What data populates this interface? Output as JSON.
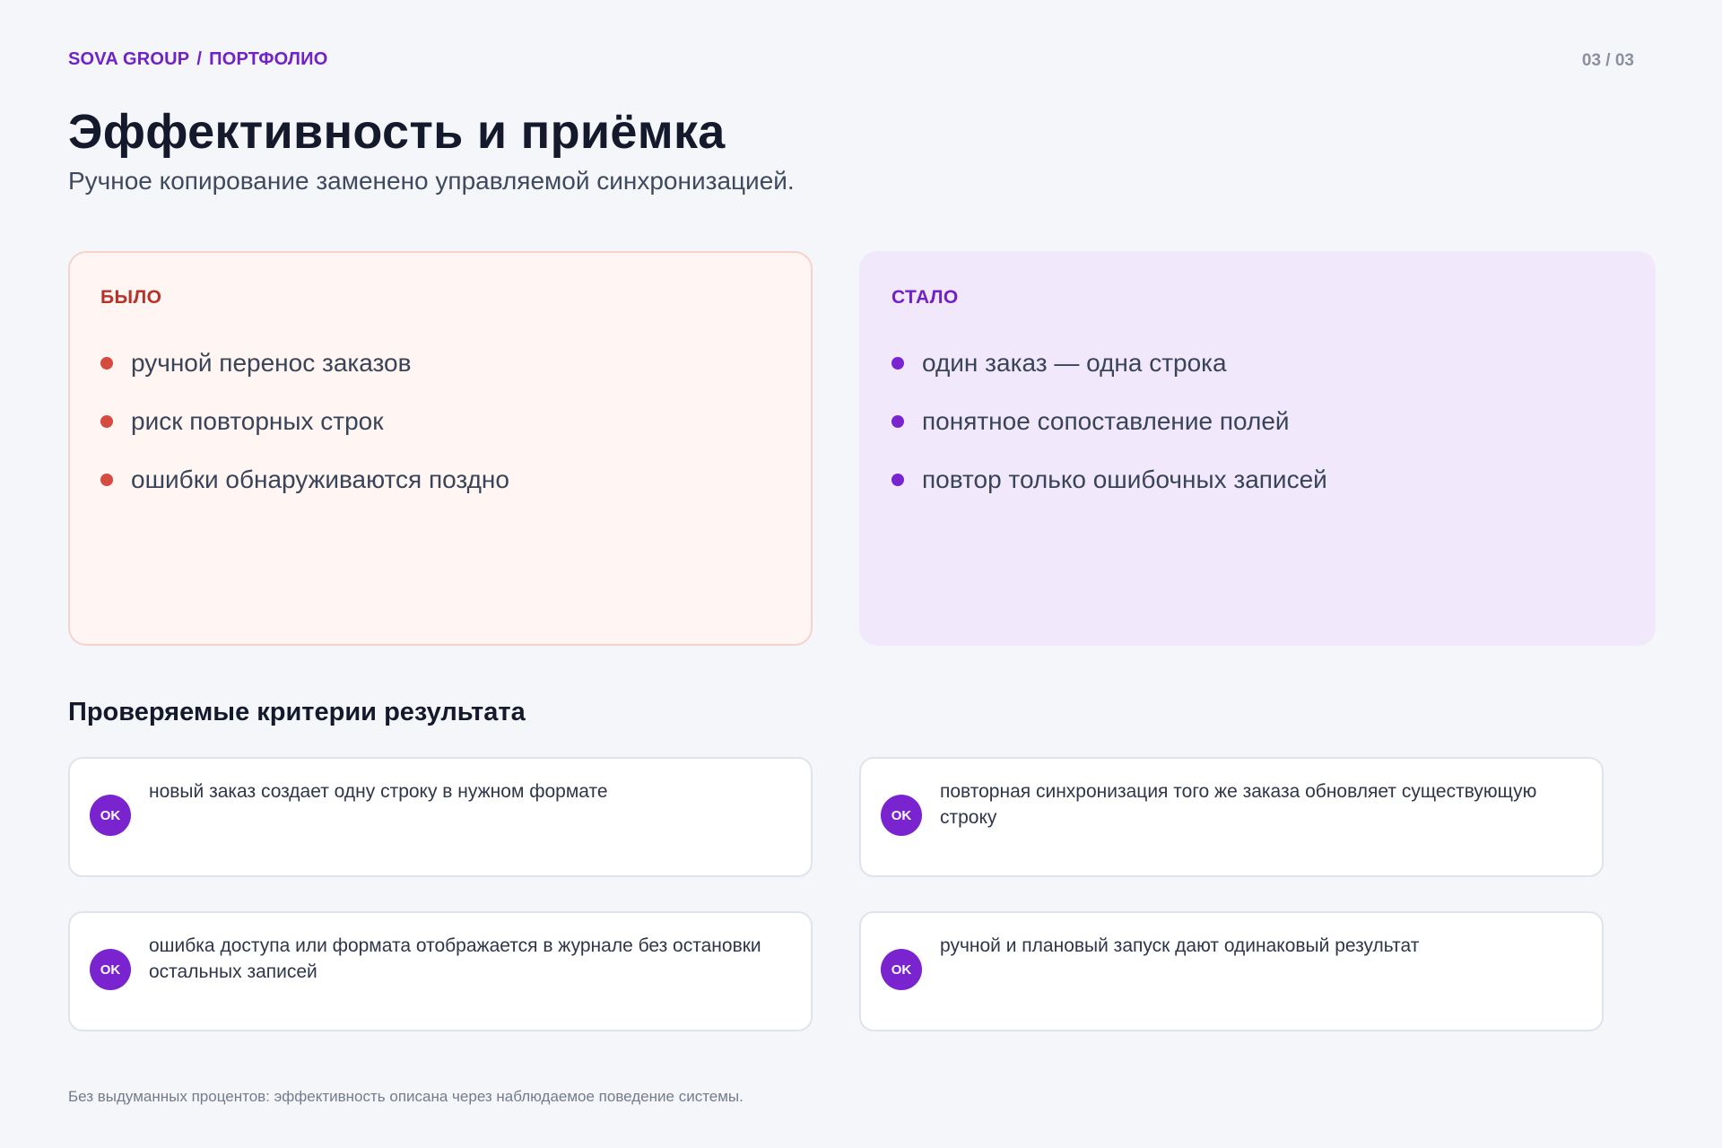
{
  "header": {
    "brand": "SOVA GROUP",
    "separator": "/",
    "section": "ПОРТФОЛИО",
    "page_counter": "03 / 03"
  },
  "title": "Эффективность и приёмка",
  "subtitle": "Ручное копирование заменено управляемой синхронизацией.",
  "before": {
    "label": "БЫЛО",
    "items": [
      "ручной перенос заказов",
      "риск повторных строк",
      "ошибки обнаруживаются поздно"
    ]
  },
  "after": {
    "label": "СТАЛО",
    "items": [
      "один заказ — одна строка",
      "понятное сопоставление полей",
      "повтор только ошибочных записей"
    ]
  },
  "criteria": {
    "heading": "Проверяемые критерии результата",
    "badge": "OK",
    "items": [
      "новый заказ создает одну строку в нужном формате",
      "повторная синхронизация того же заказа обновляет существующую строку",
      "ошибка доступа или формата отображается в журнале без остановки остальных записей",
      "ручной и плановый запуск дают одинаковый результат"
    ]
  },
  "footnote": "Без выдуманных процентов: эффективность описана через наблюдаемое поведение системы.",
  "colors": {
    "accent": "#7122c6",
    "before_accent": "#b7332a",
    "before_bg": "#fff5f3",
    "after_bg": "#f2e8fc",
    "page_bg": "#f5f6fa"
  }
}
